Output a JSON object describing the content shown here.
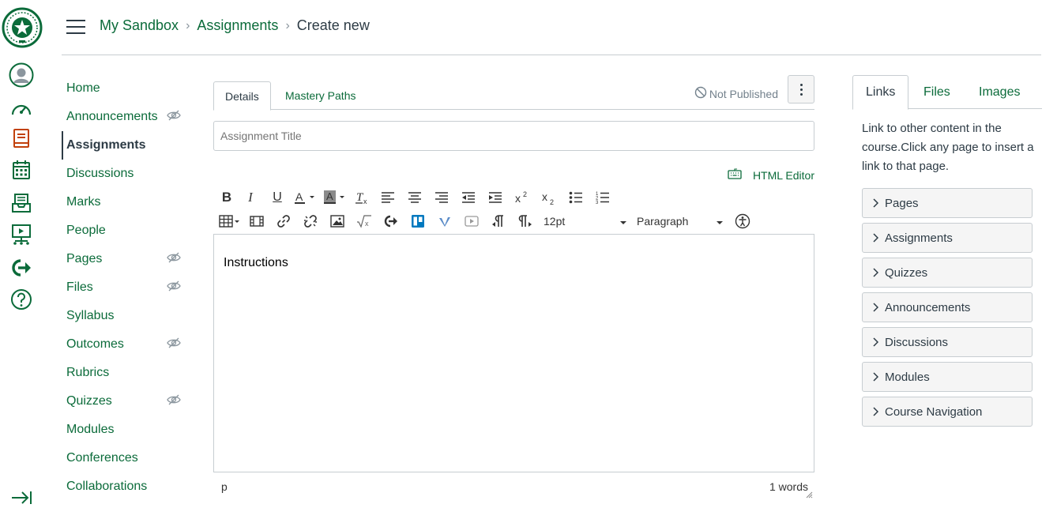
{
  "colors": {
    "brand": "#0b6b3a",
    "text": "#2d3b45",
    "muted": "#73818c",
    "border": "#c7cdd1"
  },
  "global_nav": {
    "items": [
      {
        "name": "account",
        "icon": "account-avatar-icon"
      },
      {
        "name": "dashboard",
        "icon": "dashboard-gauge-icon"
      },
      {
        "name": "courses",
        "icon": "courses-book-icon"
      },
      {
        "name": "calendar",
        "icon": "calendar-icon"
      },
      {
        "name": "inbox",
        "icon": "inbox-icon"
      },
      {
        "name": "studio",
        "icon": "studio-icon"
      },
      {
        "name": "commons",
        "icon": "commons-share-icon"
      },
      {
        "name": "help",
        "icon": "help-icon"
      }
    ],
    "collapse_icon": "collapse-nav-icon"
  },
  "header": {
    "breadcrumb": {
      "course": "My Sandbox",
      "section": "Assignments",
      "current": "Create new",
      "separator": "›"
    }
  },
  "course_nav": {
    "items": [
      {
        "label": "Home",
        "hidden": false
      },
      {
        "label": "Announcements",
        "hidden": true
      },
      {
        "label": "Assignments",
        "hidden": false,
        "active": true
      },
      {
        "label": "Discussions",
        "hidden": false
      },
      {
        "label": "Marks",
        "hidden": false
      },
      {
        "label": "People",
        "hidden": false
      },
      {
        "label": "Pages",
        "hidden": true
      },
      {
        "label": "Files",
        "hidden": true
      },
      {
        "label": "Syllabus",
        "hidden": false
      },
      {
        "label": "Outcomes",
        "hidden": true
      },
      {
        "label": "Rubrics",
        "hidden": false
      },
      {
        "label": "Quizzes",
        "hidden": true
      },
      {
        "label": "Modules",
        "hidden": false
      },
      {
        "label": "Conferences",
        "hidden": false
      },
      {
        "label": "Collaborations",
        "hidden": false
      }
    ]
  },
  "main": {
    "tabs": [
      "Details",
      "Mastery Paths"
    ],
    "publish_status": "Not Published",
    "title_placeholder": "Assignment Title",
    "html_editor_label": "HTML Editor",
    "toolbar": {
      "font_size": "12pt",
      "block_format": "Paragraph"
    },
    "editor_content": "Instructions",
    "status_path": "p",
    "word_count": "1 words"
  },
  "sidebar": {
    "tabs": [
      "Links",
      "Files",
      "Images"
    ],
    "description": "Link to other content in the course.Click any page to insert a link to that page.",
    "sections": [
      "Pages",
      "Assignments",
      "Quizzes",
      "Announcements",
      "Discussions",
      "Modules",
      "Course Navigation"
    ]
  }
}
